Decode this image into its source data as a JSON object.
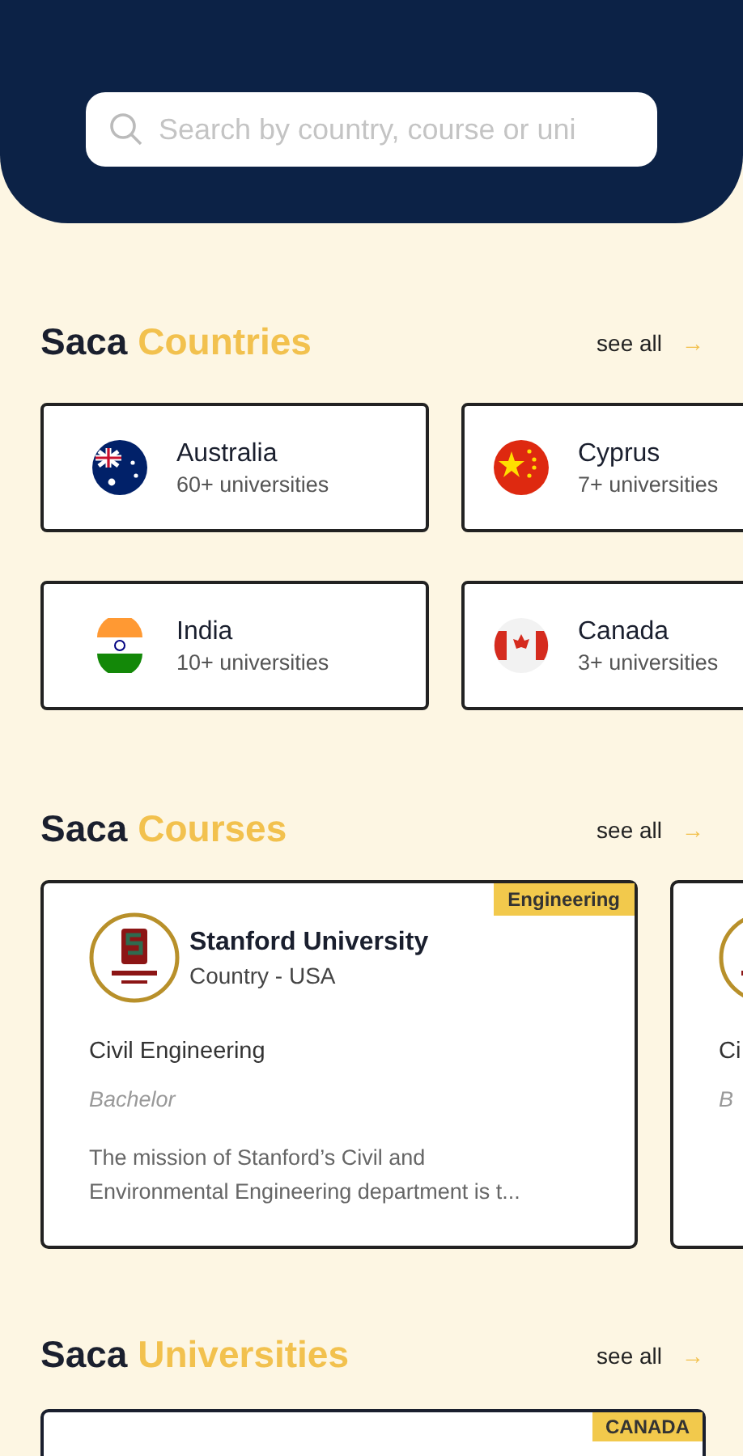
{
  "search": {
    "placeholder": "Search by country, course or uni"
  },
  "countries_section": {
    "title_prefix": "Saca",
    "title_accent": "Countries",
    "see_all": "see all",
    "arrow": "→"
  },
  "countries": [
    {
      "name": "Australia",
      "count": "60+ universities",
      "kind": "au"
    },
    {
      "name": "Cyprus",
      "count": "7+ universities",
      "kind": "cn"
    },
    {
      "name": "India",
      "count": "10+ universities",
      "kind": "in"
    },
    {
      "name": "Canada",
      "count": "3+ universities",
      "kind": "ca"
    }
  ],
  "courses_section": {
    "title_prefix": "Saca",
    "title_accent": "Courses",
    "see_all": "see all",
    "arrow": "→"
  },
  "courses": [
    {
      "tag": "Engineering",
      "university": "Stanford University",
      "country": "Country - USA",
      "course": "Civil Engineering",
      "level": "Bachelor",
      "description": "The mission of Stanford’s Civil and Environmental Engineering department is t..."
    },
    {
      "course": "Ci",
      "level": "B"
    }
  ],
  "universities_section": {
    "title_prefix": "Saca",
    "title_accent": "Universities",
    "see_all": "see all",
    "arrow": "→"
  },
  "universities": [
    {
      "tag": "CANADA"
    }
  ]
}
